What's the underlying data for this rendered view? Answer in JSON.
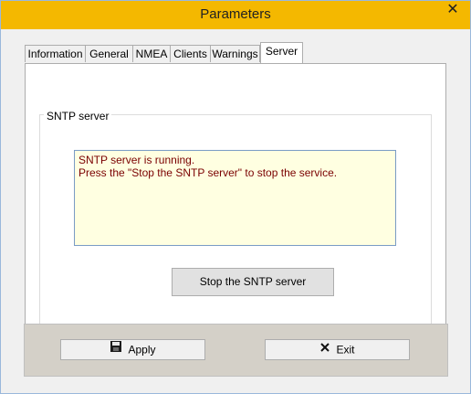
{
  "window": {
    "title": "Parameters",
    "close_icon": "close-icon"
  },
  "tabs": [
    {
      "label": "Information"
    },
    {
      "label": "General"
    },
    {
      "label": "NMEA"
    },
    {
      "label": "Clients"
    },
    {
      "label": "Warnings"
    },
    {
      "label": "Server",
      "active": true
    }
  ],
  "server": {
    "group_label": "SNTP server",
    "status_lines": [
      "SNTP server is running.",
      "Press the \"Stop the SNTP server\" to stop the service."
    ],
    "stop_button_label": "Stop the SNTP server"
  },
  "footer": {
    "apply_label": "Apply",
    "apply_icon": "save-icon",
    "exit_label": "Exit",
    "exit_icon": "x-icon"
  },
  "colors": {
    "titlebar": "#f4b800",
    "message_bg": "#ffffe1",
    "message_text": "#7a0000"
  }
}
